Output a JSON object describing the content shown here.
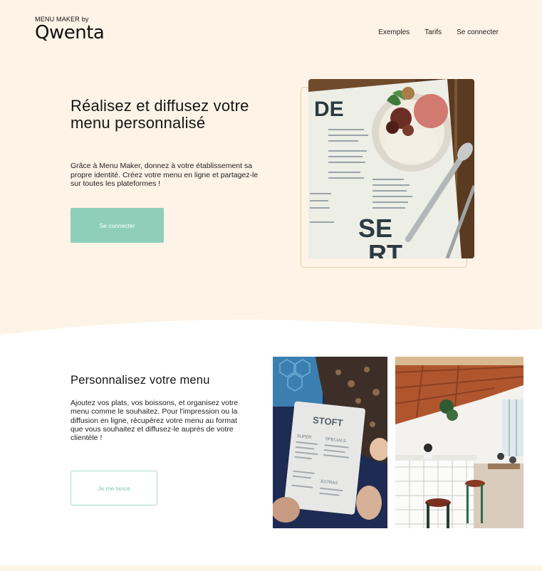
{
  "header": {
    "brand_small": "MENU MAKER by",
    "brand_logo": "Qwenta",
    "nav": [
      {
        "label": "Exemples"
      },
      {
        "label": "Tarifs"
      },
      {
        "label": "Se connecter"
      }
    ]
  },
  "hero": {
    "title": "Réalisez et diffusez votre menu personnalisé",
    "description": "Grâce à Menu Maker, donnez à votre établissement sa propre identité. Créez votre menu en ligne et partagez-le sur toutes les plateformes !",
    "cta_label": "Se connecter",
    "image": {
      "menu_word_top": "DE",
      "menu_word_mid": "SE",
      "menu_word_bot": "RT"
    }
  },
  "customize": {
    "title": "Personnalisez votre menu",
    "description": "Ajoutez vos plats, vos boissons, et organisez votre menu comme le souhaitez. Pour l'impression ou la diffusion en ligne, récupérez votre menu au format que vous souhaitez et diffusez-le auprès de votre clientèle !",
    "cta_label": "Je me lance",
    "menu_photo": {
      "brand": "STOFT",
      "col1": "SUPER",
      "col2": "SPECIALS",
      "col3": "EXTRAS"
    }
  },
  "colors": {
    "hero_bg": "#fdf3e6",
    "accent": "#8fcfba",
    "accent_outline": "#a6dcc9",
    "frame": "#e6cfa8"
  }
}
